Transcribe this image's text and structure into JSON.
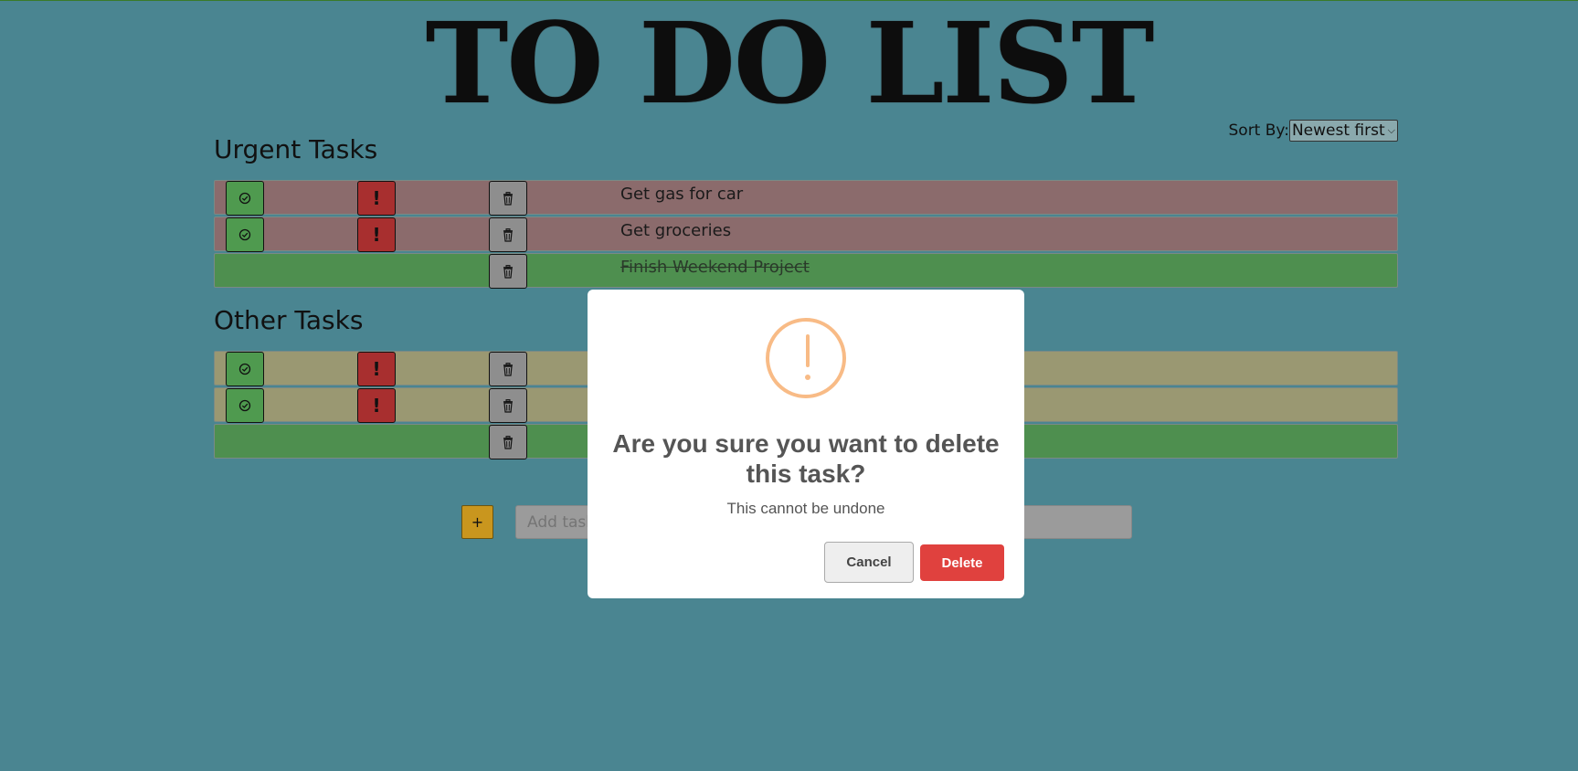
{
  "app": {
    "title": "TO DO LIST"
  },
  "sort": {
    "label": "Sort By:",
    "selected": "Newest first"
  },
  "sections": {
    "urgent": {
      "title": "Urgent Tasks",
      "tasks": [
        {
          "text": "Get gas for car",
          "status": "urgent"
        },
        {
          "text": "Get groceries",
          "status": "urgent"
        },
        {
          "text": "Finish Weekend Project",
          "status": "done"
        }
      ]
    },
    "other": {
      "title": "Other Tasks",
      "tasks": [
        {
          "text": "",
          "status": "other"
        },
        {
          "text": "",
          "status": "other"
        },
        {
          "text": "",
          "status": "done"
        }
      ]
    }
  },
  "add": {
    "button_label": "+",
    "placeholder": "Add task"
  },
  "dialog": {
    "title": "Are you sure you want to delete this task?",
    "message": "This cannot be undone",
    "cancel_label": "Cancel",
    "delete_label": "Delete"
  },
  "colors": {
    "background": "#4a8591",
    "urgent_row": "#8b6b6c",
    "other_row": "#9a9872",
    "done_row": "#4e8f4f",
    "delete_button": "#e0413e",
    "warning_icon": "#f8bb86"
  },
  "icons": {
    "complete": "check-circle-icon",
    "urgent": "exclamation-icon",
    "delete": "trash-icon",
    "warning": "warning-icon"
  }
}
